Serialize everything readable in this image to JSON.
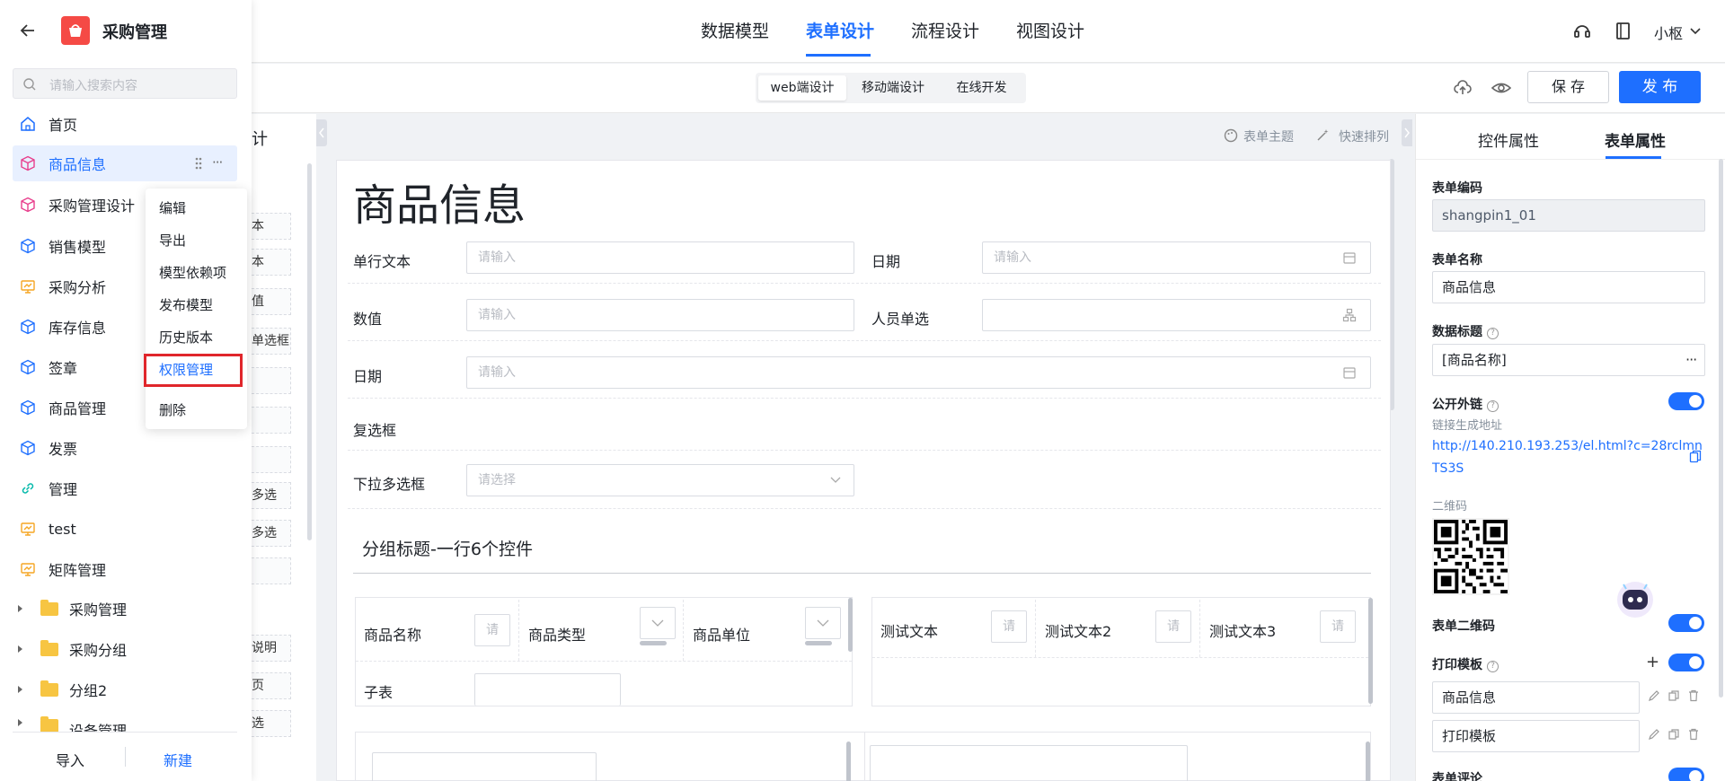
{
  "app": {
    "title": "采购管理",
    "user": "小枢"
  },
  "top_tabs": [
    {
      "label": "数据模型"
    },
    {
      "label": "表单设计"
    },
    {
      "label": "流程设计"
    },
    {
      "label": "视图设计"
    }
  ],
  "sub_tabs": [
    {
      "label": "web端设计"
    },
    {
      "label": "移动端设计"
    },
    {
      "label": "在线开发"
    }
  ],
  "toolbar": {
    "save_label": "保 存",
    "publish_label": "发 布",
    "theme_label": "表单主题",
    "arrange_label": "快速排列"
  },
  "sidebar": {
    "search_placeholder": "请输入搜索内容",
    "items": [
      {
        "label": "首页"
      },
      {
        "label": "商品信息"
      },
      {
        "label": "采购管理设计"
      },
      {
        "label": "销售模型"
      },
      {
        "label": "采购分析"
      },
      {
        "label": "库存信息"
      },
      {
        "label": "签章"
      },
      {
        "label": "商品管理"
      },
      {
        "label": "发票"
      },
      {
        "label": "管理"
      },
      {
        "label": "test"
      },
      {
        "label": "矩阵管理"
      }
    ],
    "folders": [
      {
        "label": "采购管理"
      },
      {
        "label": "采购分组"
      },
      {
        "label": "分组2"
      },
      {
        "label": "设备管理"
      }
    ],
    "import_label": "导入",
    "new_label": "新建"
  },
  "context_menu": {
    "items": [
      {
        "label": "编辑"
      },
      {
        "label": "导出"
      },
      {
        "label": "模型依赖项"
      },
      {
        "label": "发布模型"
      },
      {
        "label": "历史版本"
      },
      {
        "label": "权限管理"
      },
      {
        "label": "删除"
      }
    ]
  },
  "control_strip": {
    "header": "计",
    "items": [
      "本",
      "本",
      "",
      "值",
      "单选框",
      "",
      "",
      "",
      "多选",
      "多选",
      "",
      "选",
      "说明",
      "页",
      "选"
    ]
  },
  "form": {
    "title": "商品信息",
    "fields": {
      "single_text": {
        "label": "单行文本",
        "placeholder": "请输入"
      },
      "date1": {
        "label": "日期",
        "placeholder": "请输入"
      },
      "number": {
        "label": "数值",
        "placeholder": "请输入"
      },
      "person": {
        "label": "人员单选"
      },
      "date2": {
        "label": "日期",
        "placeholder": "请输入"
      },
      "checkbox": {
        "label": "复选框"
      },
      "multiselect": {
        "label": "下拉多选框",
        "placeholder": "请选择"
      }
    },
    "group_title": "分组标题-一行6个控件",
    "group_left": {
      "cells": [
        "商品名称",
        "商品类型",
        "商品单位"
      ],
      "subtable_label": "子表",
      "box_text": "请"
    },
    "group_right": {
      "cells": [
        "测试文本",
        "测试文本2",
        "测试文本3"
      ],
      "box_text": "请"
    }
  },
  "right_panel": {
    "tabs": [
      {
        "label": "控件属性"
      },
      {
        "label": "表单属性"
      }
    ],
    "form_code_label": "表单编码",
    "form_code_value": "shangpin1_01",
    "form_name_label": "表单名称",
    "form_name_value": "商品信息",
    "data_title_label": "数据标题",
    "data_title_value": "[商品名称]",
    "public_link_label": "公开外链",
    "link_hint": "链接生成地址",
    "link_url_line1": "http://140.210.193.253/el.html?c=28rclmn",
    "link_url_line2": "TS3S",
    "qrcode_label": "二维码",
    "form_qrcode_label": "表单二维码",
    "print_template_label": "打印模板",
    "print_templates": [
      {
        "label": "商品信息"
      },
      {
        "label": "打印模板"
      }
    ],
    "form_comment_label": "表单评论"
  },
  "colors": {
    "accent": "#1e6fff",
    "highlight_border": "#e0262b"
  }
}
